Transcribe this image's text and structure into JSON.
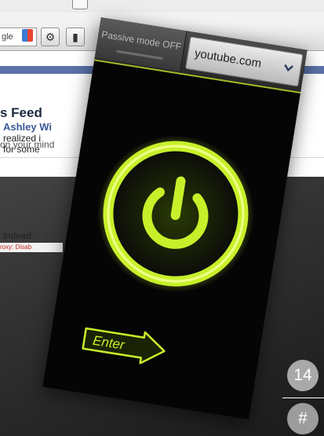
{
  "browser": {
    "search_engine_label": "gle",
    "gear_icon": "gear-icon",
    "extension_icon": "extension-icon"
  },
  "facebook": {
    "feed_title": "s Feed",
    "status_placeholder": "on your mind",
    "story_author": "Ashley Wi",
    "story_line_1": "realized i",
    "story_line_2": "for some",
    "story_line_3": "indeed.",
    "proxy_notice": "roxy: Disab"
  },
  "phone": {
    "passive_mode_label": "Passive mode OFF",
    "site_select_value": "youtube.com",
    "power_icon": "power-icon",
    "enter_label": "Enter",
    "accent_color": "#c8f02a"
  },
  "page": {
    "number": "14",
    "hash": "#"
  }
}
